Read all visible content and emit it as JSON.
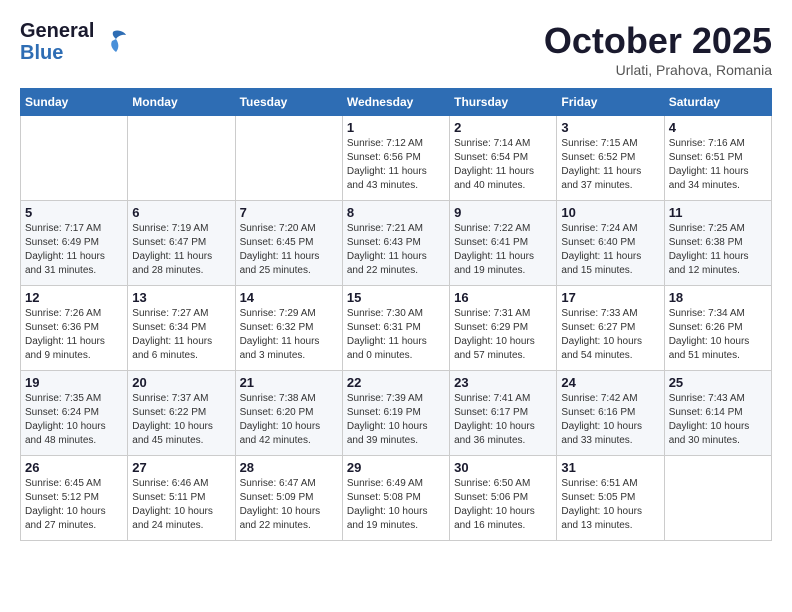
{
  "header": {
    "logo_general": "General",
    "logo_blue": "Blue",
    "month": "October 2025",
    "location": "Urlati, Prahova, Romania"
  },
  "days_of_week": [
    "Sunday",
    "Monday",
    "Tuesday",
    "Wednesday",
    "Thursday",
    "Friday",
    "Saturday"
  ],
  "weeks": [
    [
      {
        "day": "",
        "info": ""
      },
      {
        "day": "",
        "info": ""
      },
      {
        "day": "",
        "info": ""
      },
      {
        "day": "1",
        "info": "Sunrise: 7:12 AM\nSunset: 6:56 PM\nDaylight: 11 hours and 43 minutes."
      },
      {
        "day": "2",
        "info": "Sunrise: 7:14 AM\nSunset: 6:54 PM\nDaylight: 11 hours and 40 minutes."
      },
      {
        "day": "3",
        "info": "Sunrise: 7:15 AM\nSunset: 6:52 PM\nDaylight: 11 hours and 37 minutes."
      },
      {
        "day": "4",
        "info": "Sunrise: 7:16 AM\nSunset: 6:51 PM\nDaylight: 11 hours and 34 minutes."
      }
    ],
    [
      {
        "day": "5",
        "info": "Sunrise: 7:17 AM\nSunset: 6:49 PM\nDaylight: 11 hours and 31 minutes."
      },
      {
        "day": "6",
        "info": "Sunrise: 7:19 AM\nSunset: 6:47 PM\nDaylight: 11 hours and 28 minutes."
      },
      {
        "day": "7",
        "info": "Sunrise: 7:20 AM\nSunset: 6:45 PM\nDaylight: 11 hours and 25 minutes."
      },
      {
        "day": "8",
        "info": "Sunrise: 7:21 AM\nSunset: 6:43 PM\nDaylight: 11 hours and 22 minutes."
      },
      {
        "day": "9",
        "info": "Sunrise: 7:22 AM\nSunset: 6:41 PM\nDaylight: 11 hours and 19 minutes."
      },
      {
        "day": "10",
        "info": "Sunrise: 7:24 AM\nSunset: 6:40 PM\nDaylight: 11 hours and 15 minutes."
      },
      {
        "day": "11",
        "info": "Sunrise: 7:25 AM\nSunset: 6:38 PM\nDaylight: 11 hours and 12 minutes."
      }
    ],
    [
      {
        "day": "12",
        "info": "Sunrise: 7:26 AM\nSunset: 6:36 PM\nDaylight: 11 hours and 9 minutes."
      },
      {
        "day": "13",
        "info": "Sunrise: 7:27 AM\nSunset: 6:34 PM\nDaylight: 11 hours and 6 minutes."
      },
      {
        "day": "14",
        "info": "Sunrise: 7:29 AM\nSunset: 6:32 PM\nDaylight: 11 hours and 3 minutes."
      },
      {
        "day": "15",
        "info": "Sunrise: 7:30 AM\nSunset: 6:31 PM\nDaylight: 11 hours and 0 minutes."
      },
      {
        "day": "16",
        "info": "Sunrise: 7:31 AM\nSunset: 6:29 PM\nDaylight: 10 hours and 57 minutes."
      },
      {
        "day": "17",
        "info": "Sunrise: 7:33 AM\nSunset: 6:27 PM\nDaylight: 10 hours and 54 minutes."
      },
      {
        "day": "18",
        "info": "Sunrise: 7:34 AM\nSunset: 6:26 PM\nDaylight: 10 hours and 51 minutes."
      }
    ],
    [
      {
        "day": "19",
        "info": "Sunrise: 7:35 AM\nSunset: 6:24 PM\nDaylight: 10 hours and 48 minutes."
      },
      {
        "day": "20",
        "info": "Sunrise: 7:37 AM\nSunset: 6:22 PM\nDaylight: 10 hours and 45 minutes."
      },
      {
        "day": "21",
        "info": "Sunrise: 7:38 AM\nSunset: 6:20 PM\nDaylight: 10 hours and 42 minutes."
      },
      {
        "day": "22",
        "info": "Sunrise: 7:39 AM\nSunset: 6:19 PM\nDaylight: 10 hours and 39 minutes."
      },
      {
        "day": "23",
        "info": "Sunrise: 7:41 AM\nSunset: 6:17 PM\nDaylight: 10 hours and 36 minutes."
      },
      {
        "day": "24",
        "info": "Sunrise: 7:42 AM\nSunset: 6:16 PM\nDaylight: 10 hours and 33 minutes."
      },
      {
        "day": "25",
        "info": "Sunrise: 7:43 AM\nSunset: 6:14 PM\nDaylight: 10 hours and 30 minutes."
      }
    ],
    [
      {
        "day": "26",
        "info": "Sunrise: 6:45 AM\nSunset: 5:12 PM\nDaylight: 10 hours and 27 minutes."
      },
      {
        "day": "27",
        "info": "Sunrise: 6:46 AM\nSunset: 5:11 PM\nDaylight: 10 hours and 24 minutes."
      },
      {
        "day": "28",
        "info": "Sunrise: 6:47 AM\nSunset: 5:09 PM\nDaylight: 10 hours and 22 minutes."
      },
      {
        "day": "29",
        "info": "Sunrise: 6:49 AM\nSunset: 5:08 PM\nDaylight: 10 hours and 19 minutes."
      },
      {
        "day": "30",
        "info": "Sunrise: 6:50 AM\nSunset: 5:06 PM\nDaylight: 10 hours and 16 minutes."
      },
      {
        "day": "31",
        "info": "Sunrise: 6:51 AM\nSunset: 5:05 PM\nDaylight: 10 hours and 13 minutes."
      },
      {
        "day": "",
        "info": ""
      }
    ]
  ]
}
